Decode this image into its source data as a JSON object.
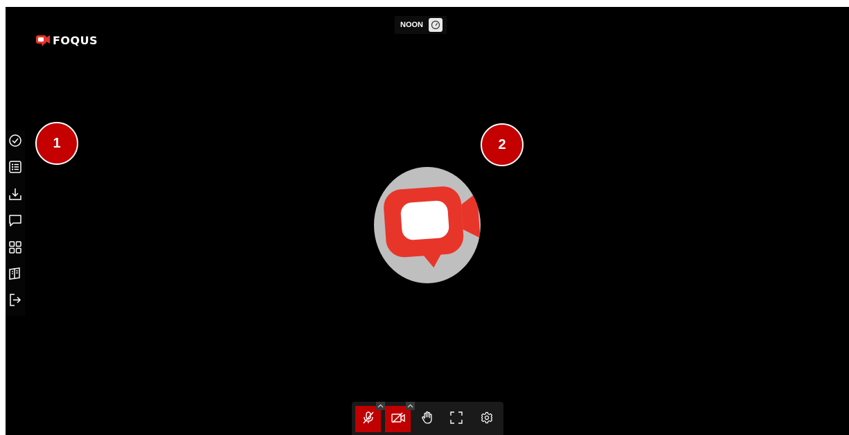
{
  "app": {
    "brand_name": "FOQUS",
    "brand_color": "#e8352a"
  },
  "room": {
    "name": "NOON",
    "speed_icon": "gauge-icon"
  },
  "sidebar": {
    "items": [
      {
        "name": "checkmark-circle-icon"
      },
      {
        "name": "list-icon"
      },
      {
        "name": "download-icon"
      },
      {
        "name": "chat-icon"
      },
      {
        "name": "apps-grid-icon"
      },
      {
        "name": "book-icon"
      },
      {
        "name": "exit-icon"
      }
    ]
  },
  "annotations": {
    "marker_1": "1",
    "marker_2": "2"
  },
  "controls": {
    "mic": {
      "icon": "mic-off-icon",
      "state": "muted",
      "color": "#c00000"
    },
    "camera": {
      "icon": "camera-off-icon",
      "state": "off",
      "color": "#c00000"
    },
    "hand": {
      "icon": "raise-hand-icon"
    },
    "fullscreen": {
      "icon": "fullscreen-icon"
    },
    "settings": {
      "icon": "gear-icon"
    }
  }
}
